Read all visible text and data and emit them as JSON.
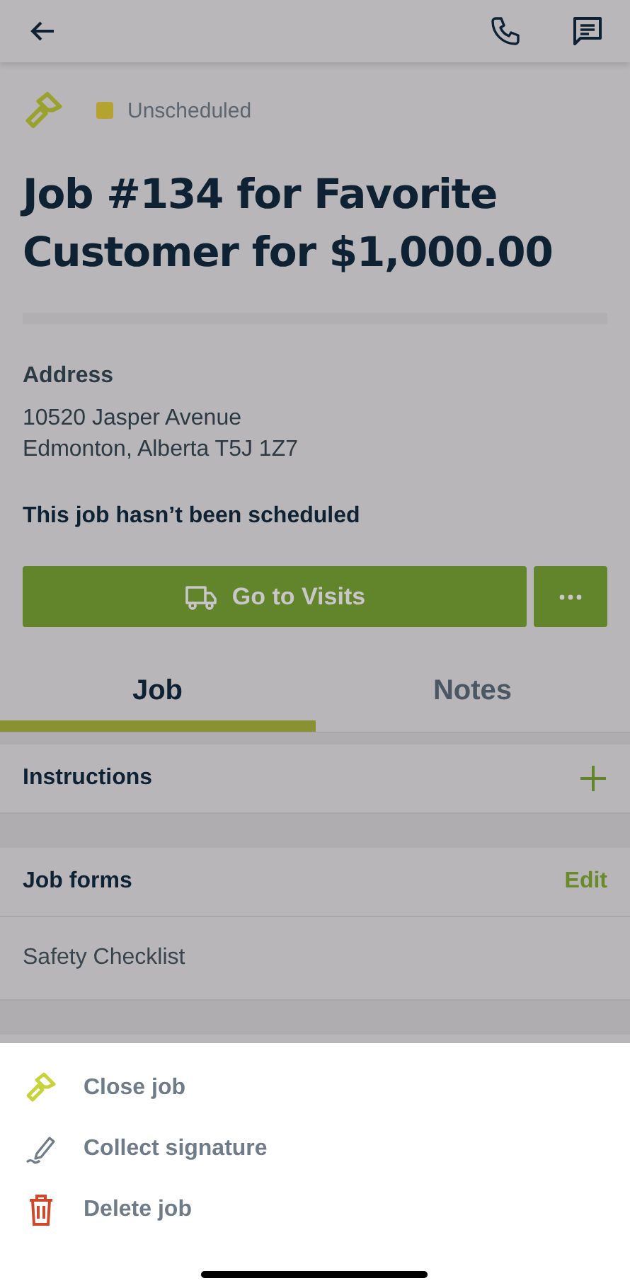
{
  "job": {
    "status": {
      "label": "Unscheduled",
      "color": "#b5a22f"
    },
    "title": "Job #134 for Favorite Customer for $1,000.00"
  },
  "progress": {
    "level": 0
  },
  "address": {
    "label": "Address",
    "lines": [
      "10520 Jasper Avenue",
      "Edmonton, Alberta T5J 1Z7"
    ]
  },
  "schedule_note": "This job hasn’t been scheduled",
  "primary_button": {
    "label": "Go to Visits"
  },
  "tabs": [
    {
      "label": "Job",
      "selected": true
    },
    {
      "label": "Notes",
      "selected": false
    }
  ],
  "sections": [
    {
      "title": "Instructions",
      "action": {
        "kind": "add"
      }
    },
    {
      "title": "Job forms",
      "action": {
        "kind": "text",
        "label": "Edit"
      },
      "items": [
        "Safety Checklist"
      ]
    }
  ],
  "sheet": {
    "actions": [
      {
        "kind": "close",
        "label": "Close job"
      },
      {
        "kind": "signature",
        "label": "Collect signature"
      },
      {
        "kind": "delete",
        "label": "Delete job"
      }
    ]
  }
}
